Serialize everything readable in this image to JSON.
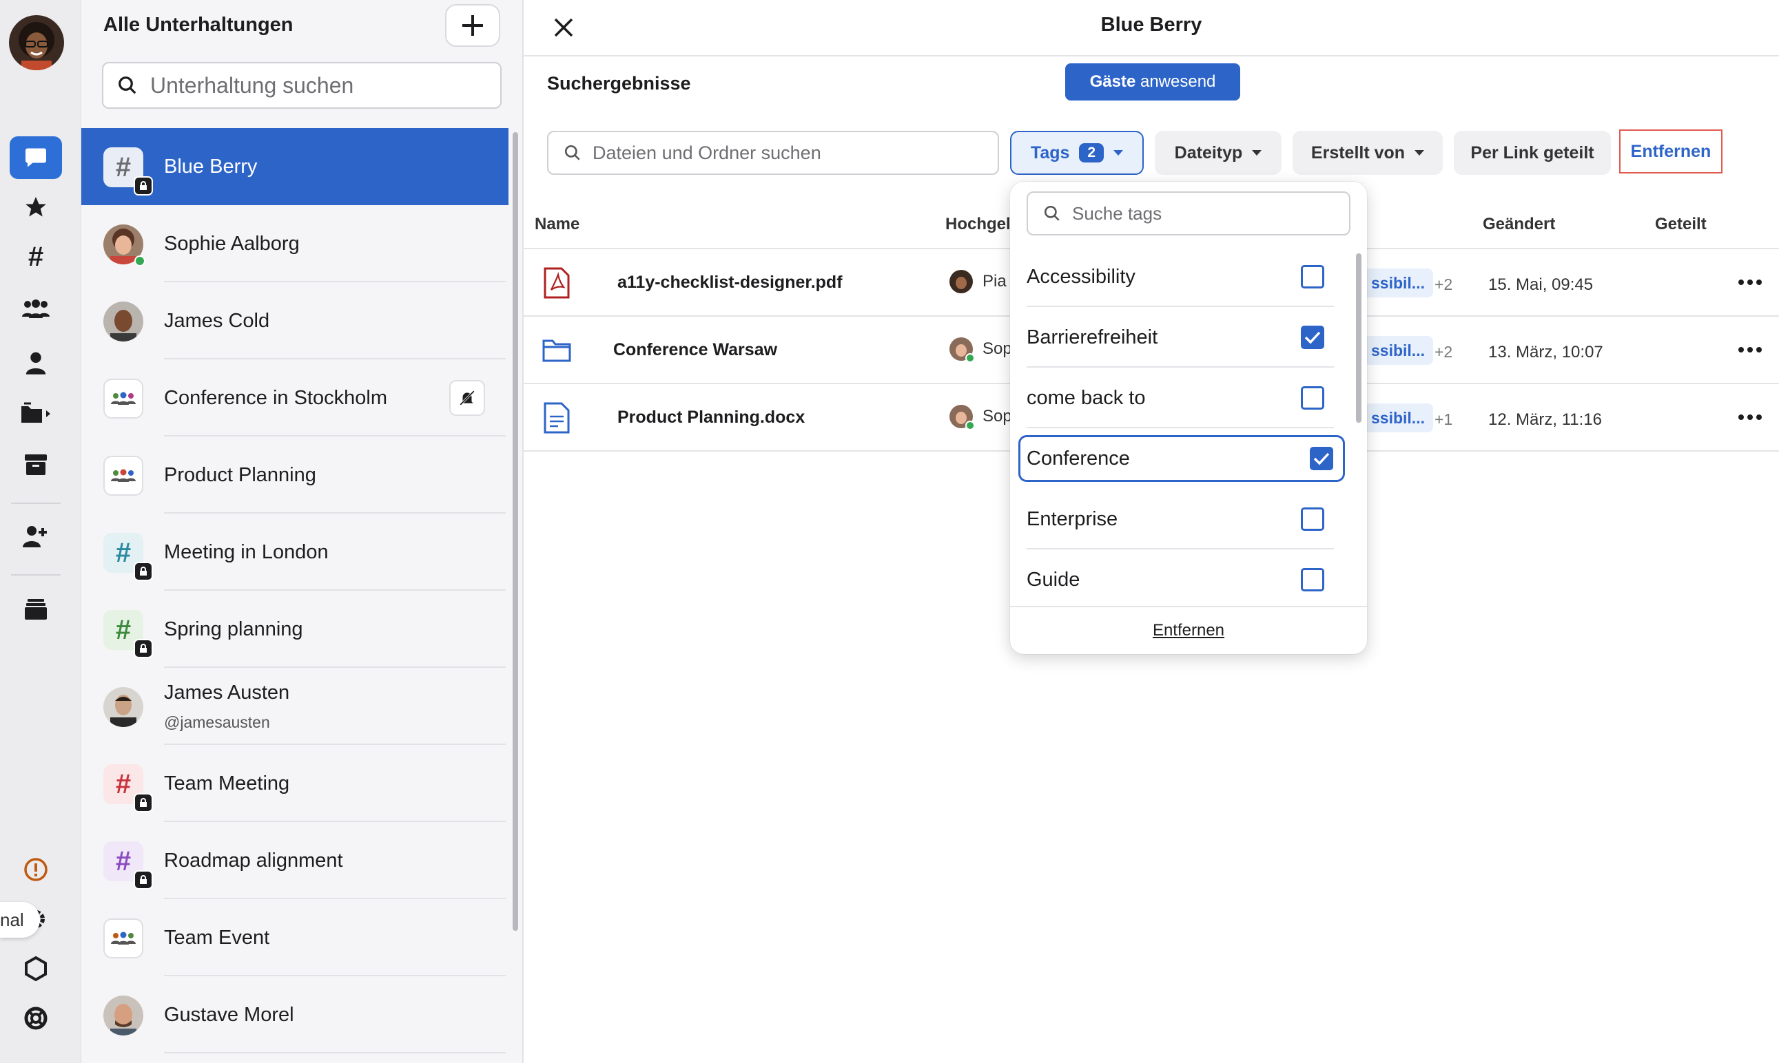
{
  "sidebar": {
    "title": "Alle Unterhaltungen",
    "search_placeholder": "Unterhaltung suchen",
    "tooltip_fragment": "nal",
    "conversations": [
      {
        "name": "Blue Berry",
        "type": "channel",
        "active": true
      },
      {
        "name": "Sophie Aalborg",
        "type": "person",
        "online": true
      },
      {
        "name": "James Cold",
        "type": "person"
      },
      {
        "name": "Conference in Stockholm",
        "type": "group",
        "muted": true
      },
      {
        "name": "Product Planning",
        "type": "group"
      },
      {
        "name": "Meeting in London",
        "type": "channel"
      },
      {
        "name": "Spring planning",
        "type": "channel"
      },
      {
        "name": "James Austen",
        "subtitle": "@jamesausten",
        "type": "person"
      },
      {
        "name": "Team Meeting",
        "type": "channel"
      },
      {
        "name": "Roadmap alignment",
        "type": "channel"
      },
      {
        "name": "Team Event",
        "type": "group"
      },
      {
        "name": "Gustave Morel",
        "type": "person"
      }
    ]
  },
  "main": {
    "title": "Blue Berry",
    "guests_bold": "Gäste",
    "guests_rest": " anwesend",
    "results_title": "Suchergebnisse",
    "file_search_placeholder": "Dateien und Ordner suchen",
    "filters": {
      "tags_label": "Tags",
      "tags_count": "2",
      "filetype_label": "Dateityp",
      "created_by_label": "Erstellt von",
      "link_shared_label": "Per Link geteilt",
      "remove_label": "Entfernen"
    },
    "columns": {
      "name": "Name",
      "uploaded": "Hochgel",
      "changed": "Geändert",
      "shared": "Geteilt"
    },
    "files": [
      {
        "name": "a11y-checklist-designer.pdf",
        "kind": "pdf",
        "uploader": "Pia",
        "tag": "ssibil...",
        "more_tags": "+2",
        "changed": "15. Mai, 09:45"
      },
      {
        "name": "Conference Warsaw",
        "kind": "folder",
        "uploader": "Sop",
        "tag": "ssibil...",
        "more_tags": "+2",
        "changed": "13. März, 10:07"
      },
      {
        "name": "Product Planning.docx",
        "kind": "doc",
        "uploader": "Sop",
        "tag": "ssibil...",
        "more_tags": "+1",
        "changed": "12. März, 11:16"
      }
    ]
  },
  "tag_dropdown": {
    "search_placeholder": "Suche tags",
    "options": [
      {
        "label": "Accessibility",
        "checked": false
      },
      {
        "label": "Barrierefreiheit",
        "checked": true
      },
      {
        "label": "come back to",
        "checked": false
      },
      {
        "label": "Conference",
        "checked": true
      },
      {
        "label": "Enterprise",
        "checked": false
      },
      {
        "label": "Guide",
        "checked": false
      }
    ],
    "footer_label": "Entfernen"
  },
  "colors": {
    "accent": "#2d64c8",
    "rail_bg": "#ececee",
    "list_bg": "#f5f5f7",
    "highlight_border": "#e05a4e"
  }
}
